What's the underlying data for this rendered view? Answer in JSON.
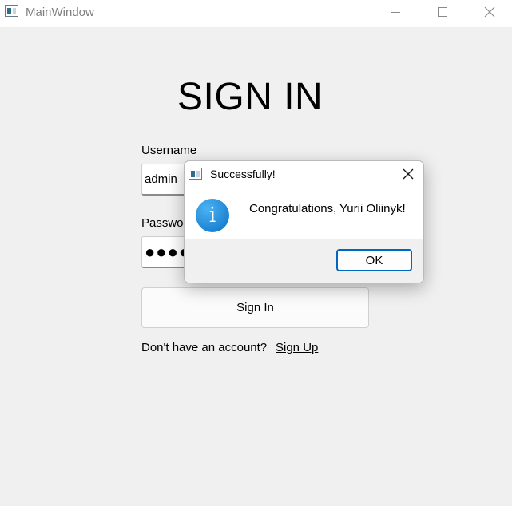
{
  "window": {
    "title": "MainWindow",
    "icon": "app-window-icon",
    "controls": [
      "minimize-icon",
      "maximize-icon",
      "close-icon"
    ]
  },
  "form": {
    "heading": "SIGN IN",
    "username_label": "Username",
    "username_value": "admin",
    "password_label": "Password",
    "password_value": "●●●●●●●●",
    "signin_button": "Sign In",
    "no_account_text": "Don't have an account?",
    "signup_link": "Sign Up"
  },
  "dialog": {
    "title": "Successfully!",
    "icon": "info-icon",
    "message": "Congratulations, Yurii Oliinyk!",
    "ok_button": "OK",
    "accent_color": "#0067c0"
  }
}
